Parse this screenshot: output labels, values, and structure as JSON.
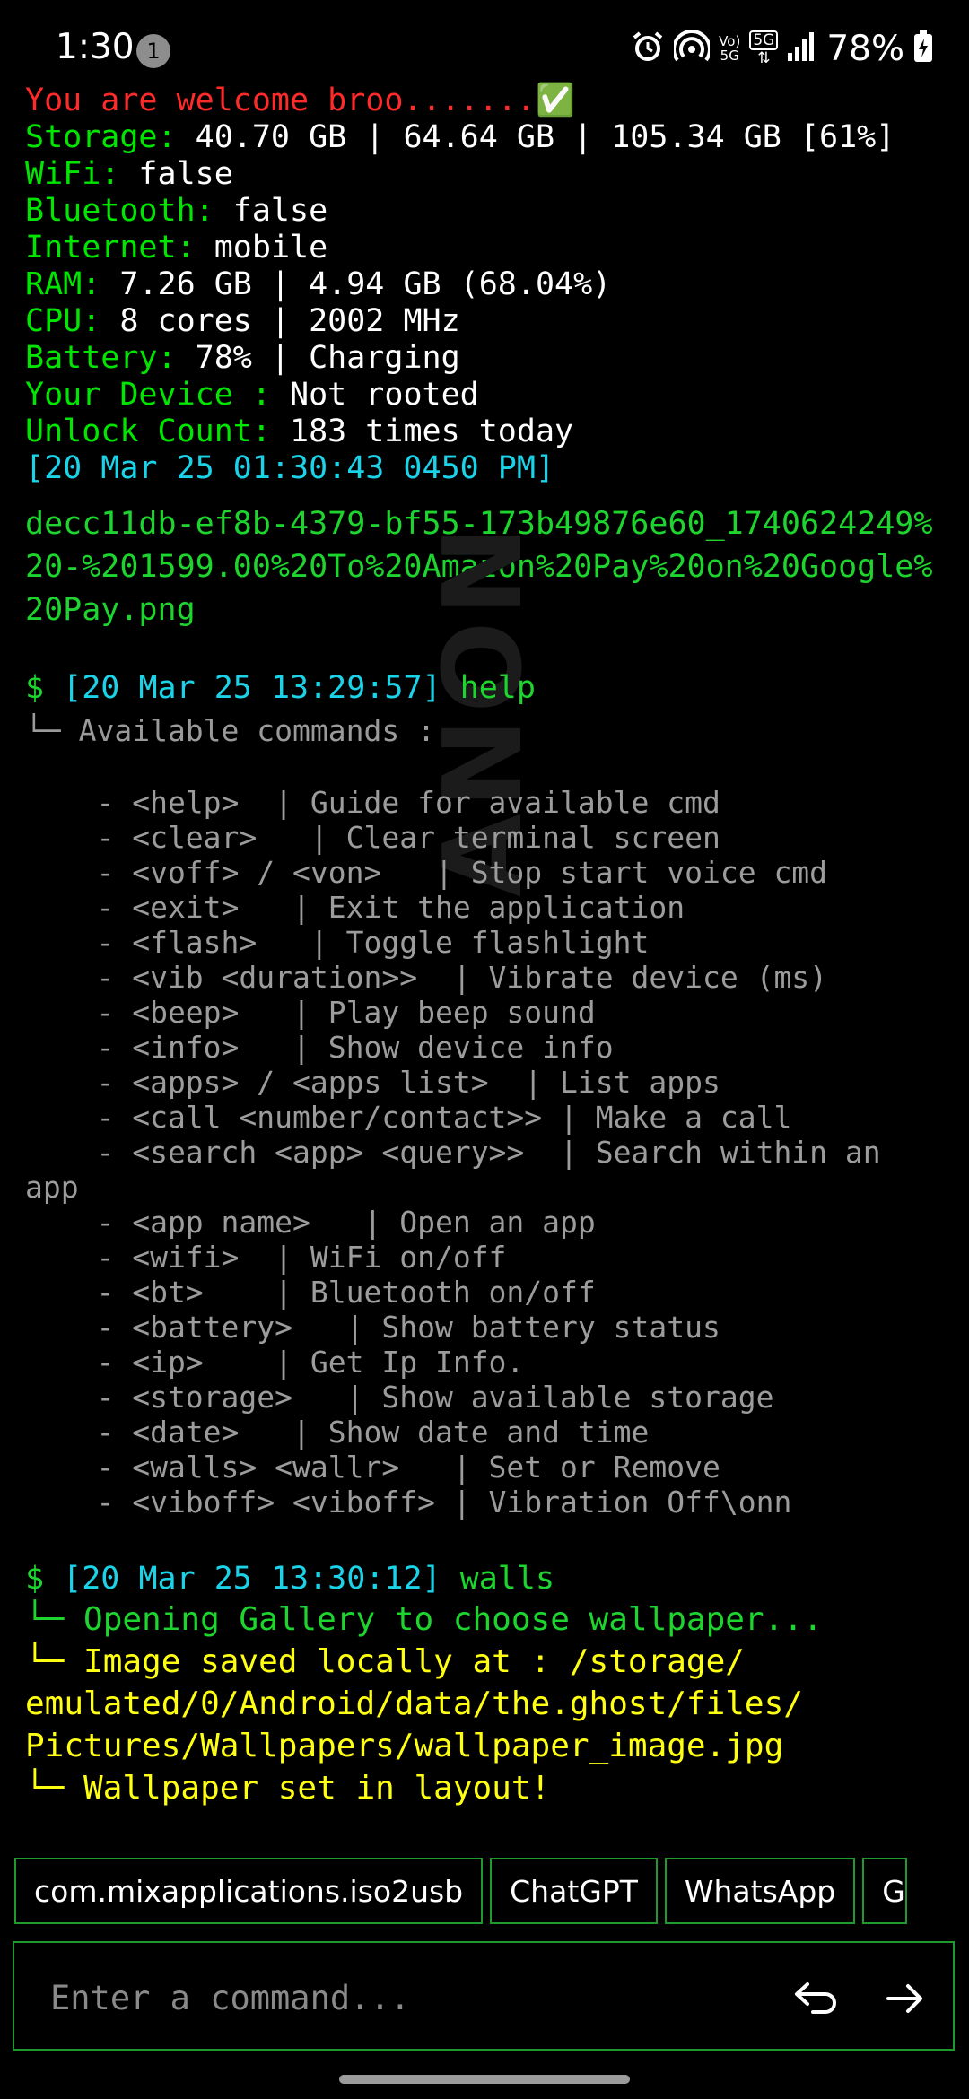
{
  "status_bar": {
    "time": "1:30",
    "notification_count": "1",
    "network_label_top": "Vo)",
    "network_label_bottom": "5G",
    "network_5g": "5G",
    "battery_percent": "78%"
  },
  "welcome": "You are welcome broo.......✅",
  "info": [
    {
      "key": "Storage:",
      "value": " 40.70 GB | 64.64 GB | 105.34 GB [61%]"
    },
    {
      "key": "WiFi:",
      "value": " false"
    },
    {
      "key": "Bluetooth:",
      "value": " false"
    },
    {
      "key": "Internet:",
      "value": " mobile"
    },
    {
      "key": "RAM:",
      "value": " 7.26 GB | 4.94 GB (68.04%)"
    },
    {
      "key": "CPU:",
      "value": " 8 cores | 2002 MHz"
    },
    {
      "key": "Battery:",
      "value": " 78% | Charging"
    },
    {
      "key": "Your Device :",
      "value": " Not rooted"
    },
    {
      "key": "Unlock Count:",
      "value": " 183 times today"
    }
  ],
  "timestamp": "[20 Mar 25 01:30:43 0450 PM]",
  "file_name": "decc11db-ef8b-4379-bf55-173b49876e60_1740624249%20-%201599.00%20To%20Amazon%20Pay%20on%20Google%20Pay.png",
  "cmd1": {
    "prompt": "$ ",
    "time": "[20 Mar 25 13:29:57]",
    "command": " help"
  },
  "help_header": "└─ Available commands :",
  "help_lines": [
    "    - <help>  | Guide for available cmd",
    "    - <clear>   | Clear terminal screen",
    "    - <voff> / <von>   | Stop start voice cmd",
    "    - <exit>   | Exit the application",
    "    - <flash>   | Toggle flashlight",
    "    - <vib <duration>>  | Vibrate device (ms)",
    "    - <beep>   | Play beep sound",
    "    - <info>   | Show device info",
    "    - <apps> / <apps list>  | List apps",
    "    - <call <number/contact>> | Make a call",
    "    - <search <app> <query>>  | Search within an",
    "app",
    "    - <app name>   | Open an app",
    "    - <wifi>  | WiFi on/off",
    "    - <bt>    | Bluetooth on/off",
    "    - <battery>   | Show battery status",
    "    - <ip>    | Get Ip Info.",
    "    - <storage>   | Show available storage",
    "    - <date>   | Show date and time",
    "    - <walls> <wallr>   | Set or Remove",
    "    - <viboff> <viboff> | Vibration Off\\onn"
  ],
  "watermark": "ANON",
  "cmd2": {
    "prompt": "$ ",
    "time": "[20 Mar 25 13:30:12]",
    "command": " walls"
  },
  "walls_output": {
    "line1": "└─ Opening Gallery to choose wallpaper...",
    "line2": "└─ Image saved locally at : /storage/",
    "line3": "emulated/0/Android/data/the.ghost/files/",
    "line4": "Pictures/Wallpapers/wallpaper_image.jpg",
    "line5": "└─ Wallpaper set in layout!"
  },
  "chips": [
    "com.mixapplications.iso2usb",
    "ChatGPT",
    "WhatsApp",
    "G"
  ],
  "input": {
    "placeholder": "Enter a command...",
    "value": ""
  },
  "colors": {
    "background": "#000000",
    "accent_green": "#1ed42e",
    "key_green": "#00e600",
    "cyan": "#1ad3e8",
    "yellow": "#ffff11",
    "red": "#ff2a2a",
    "border": "#1f9a2e"
  }
}
